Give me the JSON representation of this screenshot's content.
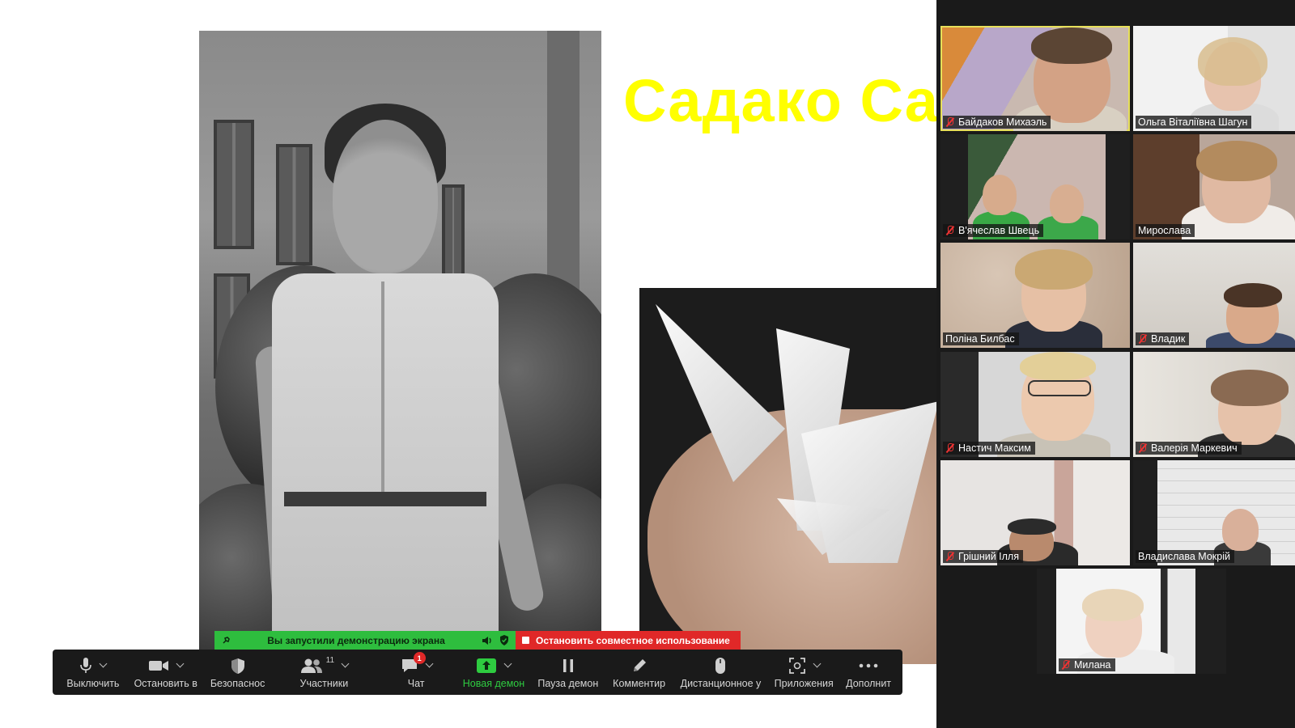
{
  "slide": {
    "title": "Садако Сас"
  },
  "share_banner": {
    "status_text": "Вы запустили демонстрацию экрана",
    "stop_label": "Остановить совместное использование"
  },
  "toolbar": {
    "mute_label": "Выключить",
    "video_label": "Остановить в",
    "security_label": "Безопаснос",
    "participants_label": "Участники",
    "participants_count": "11",
    "chat_label": "Чат",
    "chat_badge": "1",
    "new_share_label": "Новая демон",
    "pause_share_label": "Пауза демон",
    "annotate_label": "Комментир",
    "remote_label": "Дистанционное у",
    "apps_label": "Приложения",
    "more_label": "Дополнит"
  },
  "participants": [
    {
      "name": "Байдаков Михаэль",
      "muted": true,
      "active": true
    },
    {
      "name": "Ольга Віталіївна Шагун",
      "muted": false,
      "active": false
    },
    {
      "name": "В'ячеслав Швець",
      "muted": true,
      "active": false
    },
    {
      "name": "Мирослава",
      "muted": false,
      "active": false
    },
    {
      "name": "Поліна Билбас",
      "muted": false,
      "active": false
    },
    {
      "name": "Владик",
      "muted": true,
      "active": false
    },
    {
      "name": "Настич Максим",
      "muted": true,
      "active": false
    },
    {
      "name": "Валерія Маркевич",
      "muted": true,
      "active": false
    },
    {
      "name": "Грішний Ілля",
      "muted": true,
      "active": false
    },
    {
      "name": "Владислава Мокрій",
      "muted": false,
      "active": false
    },
    {
      "name": "Милана",
      "muted": true,
      "active": false
    }
  ],
  "colors": {
    "title_yellow": "#ffff00",
    "share_green": "#2ebd3e",
    "stop_red": "#e02828",
    "toolbar_bg": "#1a1a1a",
    "active_speaker": "#e7e05a"
  }
}
